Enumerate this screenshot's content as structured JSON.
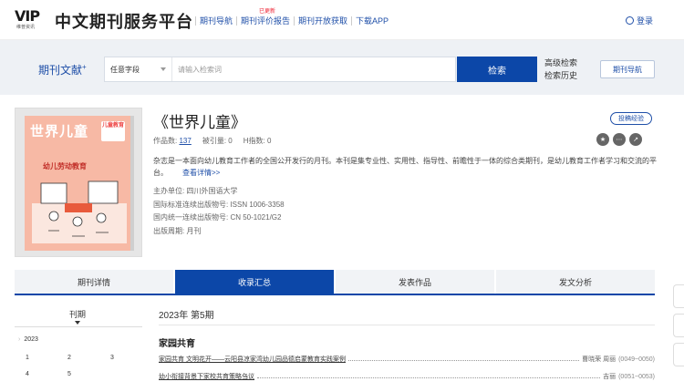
{
  "header": {
    "logo_text": "VIP",
    "logo_sub": "维普资讯",
    "site_title": "中文期刊服务平台",
    "nav": [
      {
        "label": "期刊导航"
      },
      {
        "label": "期刊评价报告",
        "badge": "已更新"
      },
      {
        "label": "期刊开放获取"
      },
      {
        "label": "下载APP"
      }
    ],
    "login_label": "登录"
  },
  "search": {
    "section_title": "期刊文献",
    "section_mark": "+",
    "field_select": "任意字段",
    "placeholder": "请输入检索词",
    "search_button": "检索",
    "advanced": "高级检索",
    "history": "检索历史",
    "journal_nav_button": "期刊导航"
  },
  "journal": {
    "title": "《世界儿童》",
    "cover": {
      "title": "世界儿童",
      "tag": "儿童教育",
      "subtitle": "幼儿劳动教育"
    },
    "stats": [
      {
        "label": "作品数:",
        "value": "137",
        "link": true
      },
      {
        "label": "被引量:",
        "value": "0",
        "link": false
      },
      {
        "label": "H指数:",
        "value": "0",
        "link": false
      }
    ],
    "submit_label": "投稿经验",
    "action_icons": [
      "star-icon",
      "share-icon",
      "external-link-icon"
    ],
    "description": "杂志是一本面向幼儿教育工作者的全国公开发行的月刊。本刊是集专业性、实用性、指导性、前瞻性于一体的综合类期刊，是幼儿教育工作者学习和交流的平台。",
    "more_label": "查看详情>>",
    "meta": [
      "主办单位: 四川外国语大学",
      "国际标准连续出版物号: ISSN 1006-3358",
      "国内统一连续出版物号: CN 50-1021/G2",
      "出版周期: 月刊"
    ]
  },
  "tabs": [
    {
      "label": "期刊详情",
      "active": false
    },
    {
      "label": "收录汇总",
      "active": true
    },
    {
      "label": "发表作品",
      "active": false
    },
    {
      "label": "发文分析",
      "active": false
    }
  ],
  "issues": {
    "header": "刊期",
    "year": "2023",
    "numbers": [
      "1",
      "2",
      "3",
      "4",
      "5"
    ]
  },
  "contents": {
    "issue_title": "2023年 第5期",
    "column": "家园共育",
    "articles": [
      {
        "title": "家园共育 文明花开——云阳县凉家湾幼儿园品德启蒙教育实践案例",
        "author": "曹晓荣 周丽",
        "pages": "(0049~0050)"
      },
      {
        "title": "幼小衔接背景下家校共育策略刍议",
        "author": "吉丽",
        "pages": "(0051~0053)"
      }
    ]
  }
}
